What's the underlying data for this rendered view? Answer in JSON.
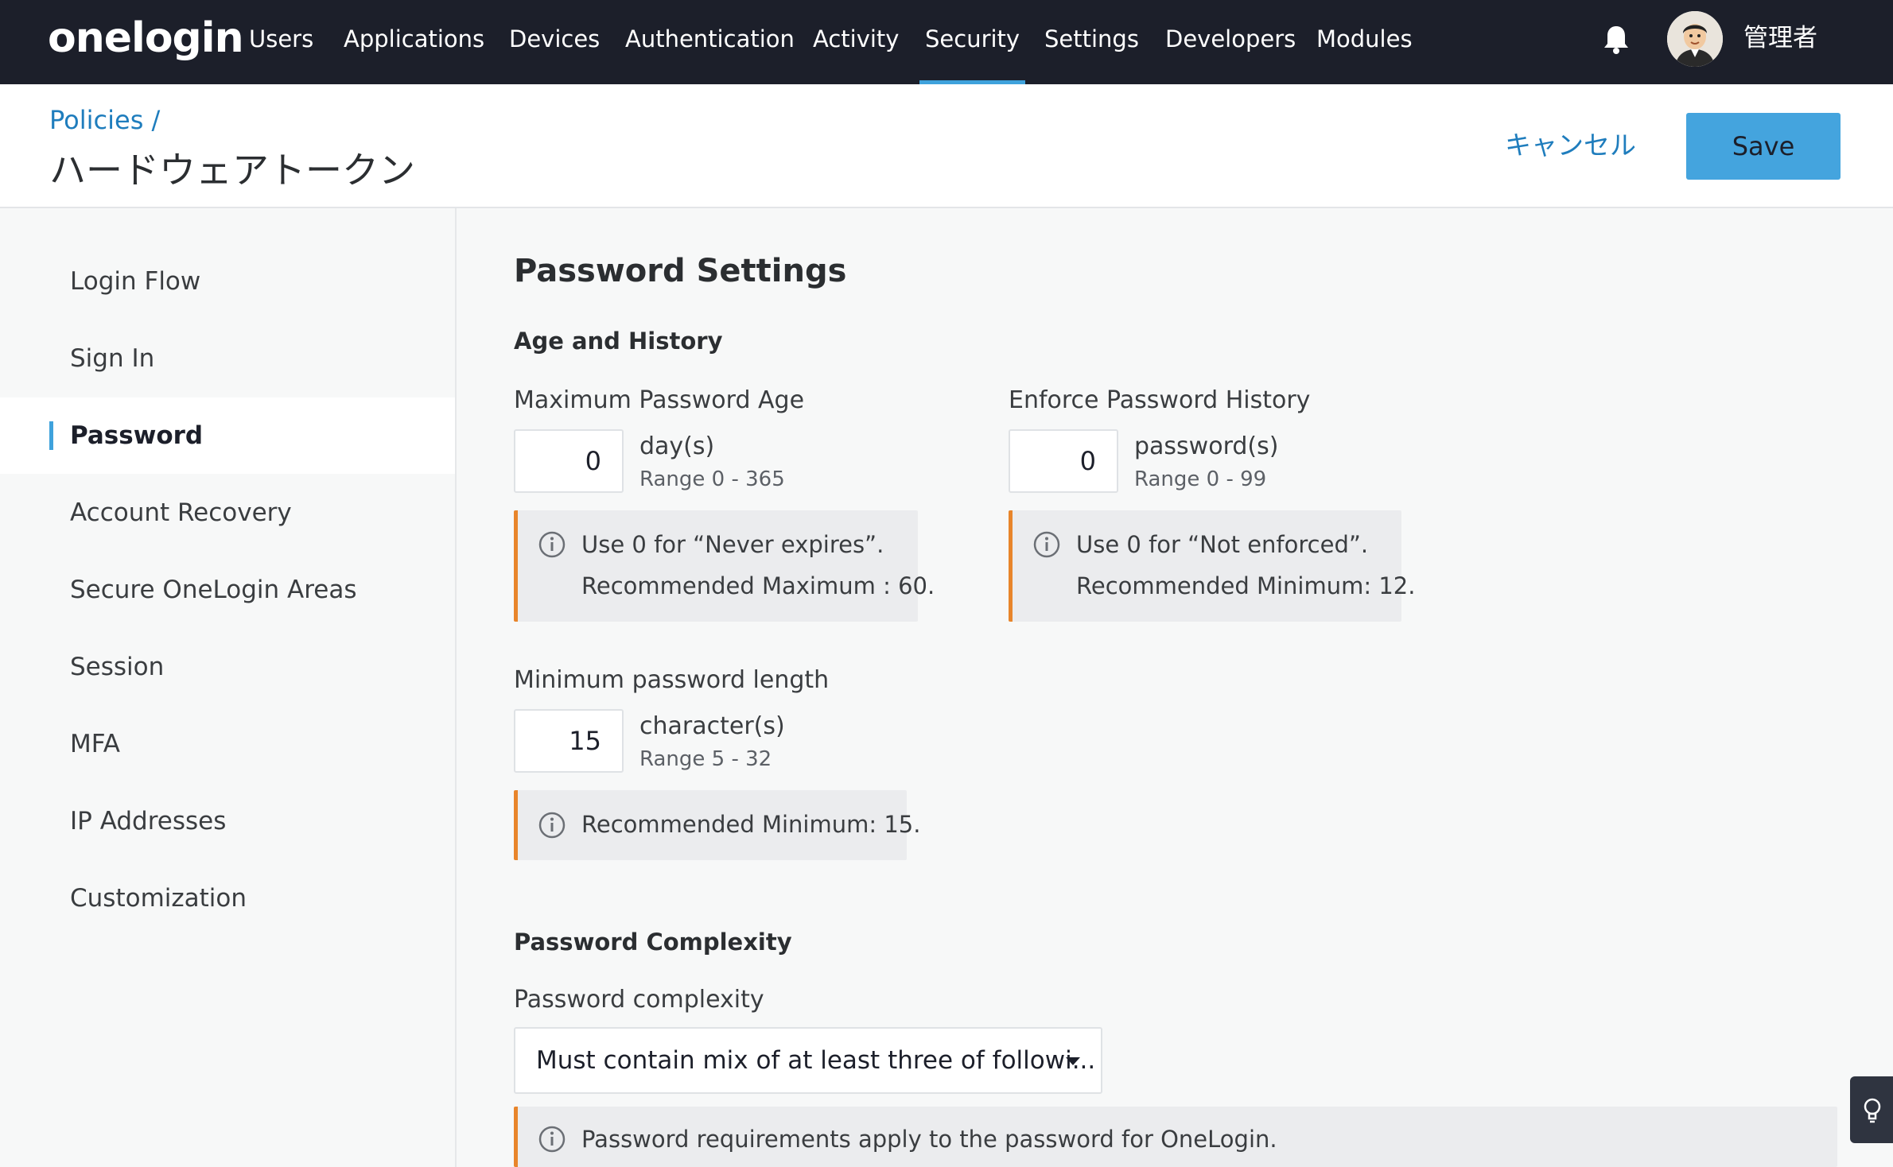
{
  "app": {
    "logo_text": "onelogin"
  },
  "nav": {
    "items": [
      {
        "label": "Users"
      },
      {
        "label": "Applications"
      },
      {
        "label": "Devices"
      },
      {
        "label": "Authentication"
      },
      {
        "label": "Activity"
      },
      {
        "label": "Security"
      },
      {
        "label": "Settings"
      },
      {
        "label": "Developers"
      },
      {
        "label": "Modules"
      }
    ],
    "active": "Security",
    "notification_icon": "bell-icon",
    "user_name": "管理者"
  },
  "header": {
    "breadcrumb": "Policies /",
    "title": "ハードウェアトークン",
    "cancel_label": "キャンセル",
    "save_label": "Save"
  },
  "sidebar": {
    "items": [
      {
        "label": "Login Flow"
      },
      {
        "label": "Sign In"
      },
      {
        "label": "Password"
      },
      {
        "label": "Account Recovery"
      },
      {
        "label": "Secure OneLogin Areas"
      },
      {
        "label": "Session"
      },
      {
        "label": "MFA"
      },
      {
        "label": "IP Addresses"
      },
      {
        "label": "Customization"
      }
    ],
    "active": "Password"
  },
  "main": {
    "title": "Password Settings",
    "age_history": {
      "heading": "Age and History",
      "max_age": {
        "label": "Maximum Password Age",
        "value": "0",
        "unit": "day(s)",
        "range": "Range 0 - 365",
        "note_line1": "Use 0 for “Never expires”.",
        "note_line2": "Recommended Maximum : 60."
      },
      "history": {
        "label": "Enforce Password History",
        "value": "0",
        "unit": "password(s)",
        "range": "Range 0 - 99",
        "note_line1": "Use 0 for “Not enforced”.",
        "note_line2": "Recommended Minimum: 12."
      },
      "min_length": {
        "label": "Minimum password length",
        "value": "15",
        "unit": "character(s)",
        "range": "Range 5 - 32",
        "note_line1": "Recommended Minimum: 15."
      }
    },
    "complexity": {
      "heading": "Password Complexity",
      "label": "Password complexity",
      "selected": "Must contain mix of at least three of followi...",
      "note_line1": "Password requirements apply to the password for OneLogin."
    }
  },
  "colors": {
    "topbar": "#1c1f2a",
    "accent": "#3fa2dc",
    "save_button": "#44a4de",
    "link": "#1f7dbd",
    "note_border": "#e8852b"
  }
}
